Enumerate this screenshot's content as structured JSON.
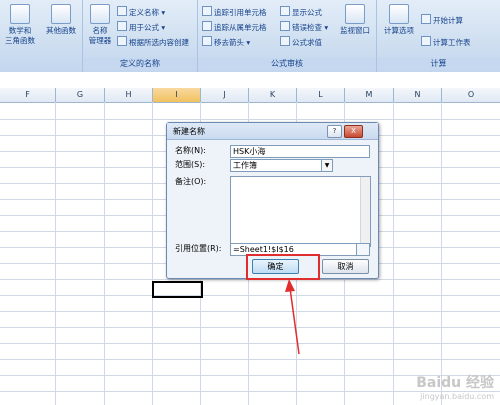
{
  "ribbon": {
    "group_function_library_partial": {
      "buttons": [
        {
          "label_line1": "数学和",
          "label_line2": "三角函数"
        },
        {
          "label_line1": "其他函数",
          "label_line2": ""
        }
      ]
    },
    "group_defined_names": {
      "label": "定义的名称",
      "name_manager_line1": "名称",
      "name_manager_line2": "管理器",
      "define_name": "定义名称",
      "use_in_formula": "用于公式",
      "create_from_selection": "根据所选内容创建"
    },
    "group_formula_auditing": {
      "label": "公式审核",
      "trace_precedents": "追踪引用单元格",
      "trace_dependents": "追踪从属单元格",
      "remove_arrows": "移去箭头",
      "show_formulas": "显示公式",
      "error_checking": "错误检查",
      "evaluate_formula": "公式求值",
      "watch_window": "监视窗口"
    },
    "group_calculation": {
      "label": "计算",
      "calc_options": "计算选项",
      "calc_now": "开始计算",
      "calc_sheet": "计算工作表"
    }
  },
  "sheet": {
    "columns": [
      "F",
      "G",
      "H",
      "I",
      "J",
      "K",
      "L",
      "M",
      "N",
      "O"
    ],
    "active_column": "I"
  },
  "dialog": {
    "title": "新建名称",
    "help_btn": "?",
    "close_btn": "X",
    "name_label": "名称(N):",
    "name_value": "HSK小海",
    "scope_label": "范围(S):",
    "scope_value": "工作簿",
    "comment_label": "备注(O):",
    "refers_to_label": "引用位置(R):",
    "refers_to_value": "=Sheet1!$I$16",
    "ok_label": "确定",
    "cancel_label": "取消"
  },
  "watermark": {
    "line1": "Baidu 经验",
    "line2": "jingyan.baidu.com"
  },
  "colors": {
    "highlight_red": "#e02d2d",
    "ribbon_blue": "#15428b"
  }
}
